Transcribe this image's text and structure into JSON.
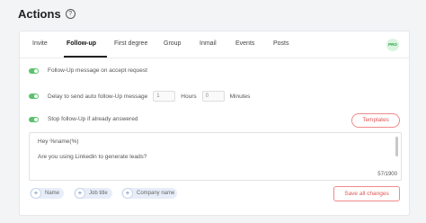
{
  "header": {
    "title": "Actions",
    "help_icon": "?"
  },
  "tabs": [
    {
      "label": "Invite"
    },
    {
      "label": "Follow-up"
    },
    {
      "label": "First degree"
    },
    {
      "label": "Group"
    },
    {
      "label": "Inmail"
    },
    {
      "label": "Events"
    },
    {
      "label": "Posts"
    }
  ],
  "active_tab": "Follow-up",
  "pro_badge": "PRO",
  "settings": {
    "accept_toggle_label": "Follow-Up message on accept request",
    "delay_label": "Delay to send auto follow-Up message",
    "delay_hours_value": "1",
    "delay_hours_unit": "Hours",
    "delay_minutes_value": "0",
    "delay_minutes_unit": "Minutes",
    "stop_label": "Stop follow-Up if already answered"
  },
  "templates_button": "Templates",
  "message": {
    "line1": "Hey %name(%)",
    "line2": "Are you using Linkedin to generate leads?",
    "counter": "57/1900"
  },
  "chips": [
    {
      "label": "Name"
    },
    {
      "label": "Job title"
    },
    {
      "label": "Company name"
    }
  ],
  "save_button": "Save all changes",
  "colors": {
    "toggle_on": "#5cc26e",
    "accent_red": "#e05656",
    "pro_green": "#2f9e44"
  }
}
